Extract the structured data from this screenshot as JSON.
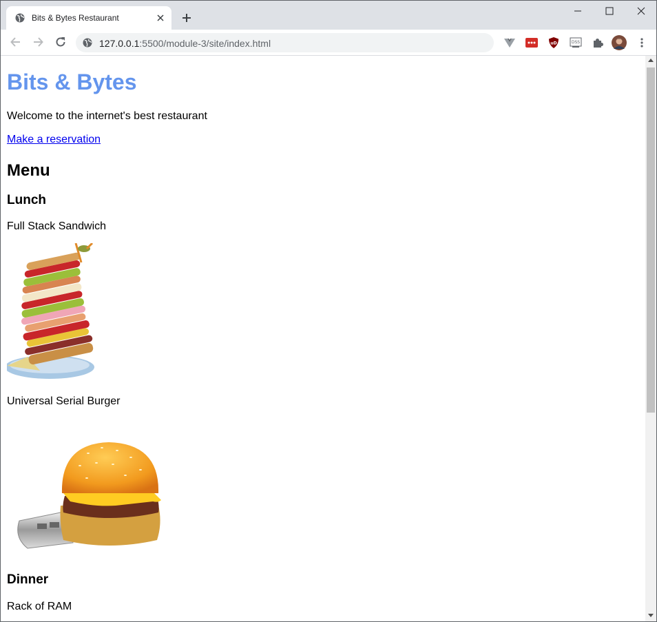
{
  "browser": {
    "tab_title": "Bits & Bytes Restaurant",
    "url_host": "127.0.0.1",
    "url_path": ":5500/module-3/site/index.html"
  },
  "page": {
    "title": "Bits & Bytes",
    "welcome": "Welcome to the internet's best restaurant",
    "reservation_link": "Make a reservation",
    "menu_heading": "Menu",
    "lunch_heading": "Lunch",
    "lunch_items": [
      "Full Stack Sandwich",
      "Universal Serial Burger"
    ],
    "dinner_heading": "Dinner",
    "dinner_items": [
      "Rack of RAM"
    ]
  },
  "colors": {
    "title": "#6495ed",
    "link": "#0000ee",
    "tabstrip": "#dee1e6"
  },
  "icons": [
    "globe-icon",
    "close-icon",
    "plus-icon",
    "minimize-icon",
    "maximize-icon",
    "back-icon",
    "forward-icon",
    "reload-icon",
    "extensions-icon",
    "menu-dots-icon"
  ]
}
